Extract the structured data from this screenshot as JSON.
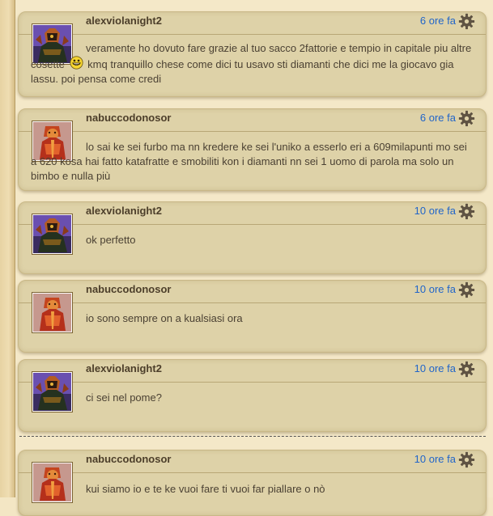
{
  "messages": [
    {
      "author": "alexviolanight2",
      "time": "6 ore fa",
      "text_before": "veramente ho dovuto fare grazie al tuo sacco 2fattorie e tempio in capitale piu altre cosette",
      "text_after": "kmq tranquillo chese come dici tu usavo sti diamanti che dici me la giocavo gia lassu. poi pensa come credi"
    },
    {
      "author": "nabuccodonosor",
      "time": "6 ore fa",
      "text": "lo sai ke sei furbo ma nn kredere ke sei l'uniko a esserlo eri a 609milapunti mo sei a 620 kosa hai fatto katafratte e smobiliti kon i diamanti nn sei 1 uomo di parola ma solo un bimbo e nulla più"
    },
    {
      "author": "alexviolanight2",
      "time": "10 ore fa",
      "text": "ok perfetto"
    },
    {
      "author": "nabuccodonosor",
      "time": "10 ore fa",
      "text": "io sono sempre on a kualsiasi ora"
    },
    {
      "author": "alexviolanight2",
      "time": "10 ore fa",
      "text": "ci sei nel pome?"
    },
    {
      "author": "nabuccodonosor",
      "time": "10 ore fa",
      "text": "kui siamo io e te ke vuoi fare ti vuoi far piallare o nò"
    }
  ],
  "icons": {
    "settings": "gear-icon",
    "smiley": "grin-smiley-icon",
    "avatar_alex": "knight-avatar",
    "avatar_nabucco": "warrior-avatar"
  },
  "colors": {
    "time_link": "#2165c9",
    "author": "#4c3e2a",
    "card": "#ded2a8"
  }
}
